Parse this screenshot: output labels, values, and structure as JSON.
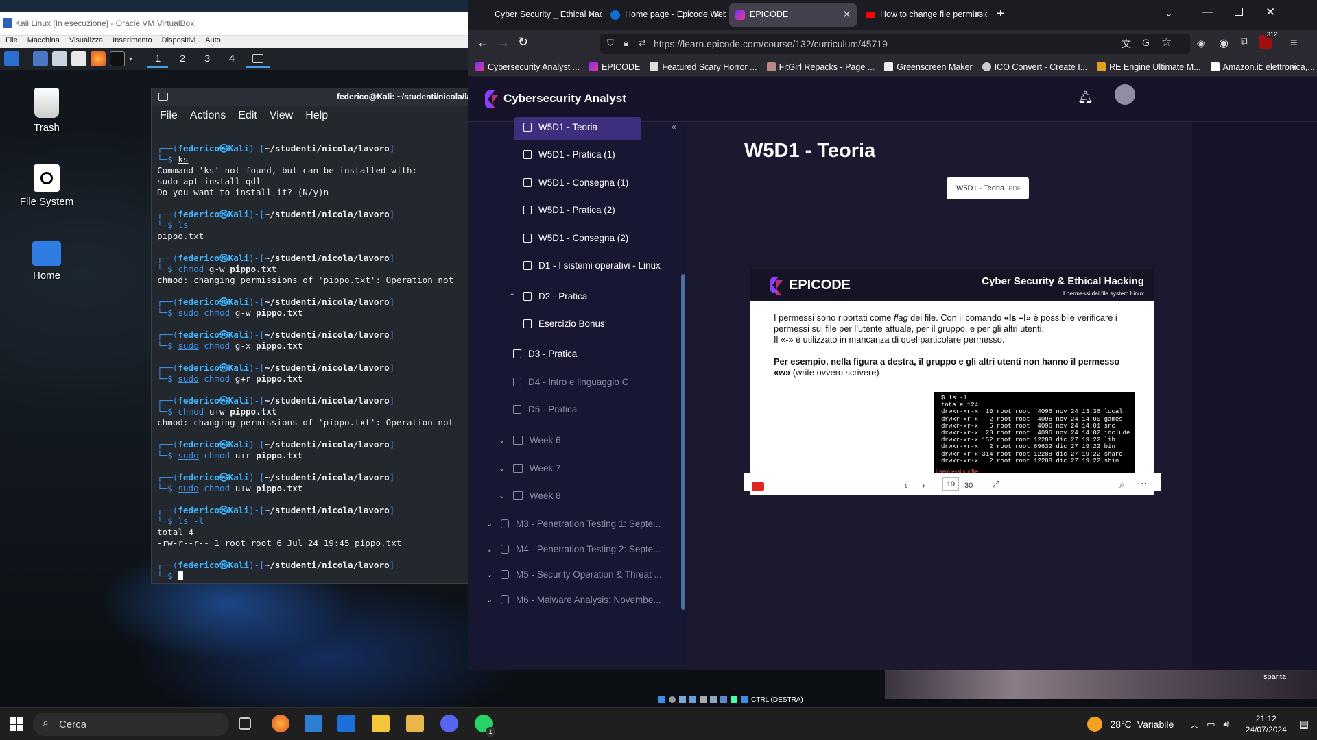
{
  "vbox": {
    "title": "Kali Linux [In esecuzione] - Oracle VM VirtualBox",
    "menu": [
      "File",
      "Macchina",
      "Visualizza",
      "Inserimento",
      "Dispositivi",
      "Auto"
    ]
  },
  "kali": {
    "workspaces": [
      "1",
      "2",
      "3",
      "4"
    ],
    "desktop_icons": [
      "Trash",
      "File System",
      "Home"
    ],
    "terminal": {
      "title": "federico@Kali: ~/studenti/nicola/lavoro",
      "menu": [
        "File",
        "Actions",
        "Edit",
        "View",
        "Help"
      ],
      "prompt_user": "federico",
      "prompt_host": "Kali",
      "prompt_path": "~/studenti/nicola/lavoro",
      "lines": {
        "c1": "ks",
        "o1a": "Command 'ks' not found, but can be installed with:",
        "o1b": "sudo apt install qdl",
        "o1c": "Do you want to install it? (N/y)n",
        "c2": "ls",
        "o2": "pippo.txt",
        "c3a": "chmod",
        "c3b": "g-w",
        "c3c": "pippo.txt",
        "o3": "chmod: changing permissions of 'pippo.txt': Operation not",
        "sudo": "sudo",
        "chmod": "chmod",
        "c4b": "g-w",
        "c5b": "g-x",
        "c6b": "g+r",
        "c7b": "u+w",
        "o7": "chmod: changing permissions of 'pippo.txt': Operation not",
        "c8b": "u+r",
        "c9b": "u+w",
        "file": "pippo.txt",
        "c10": "ls -l",
        "o10a": "total 4",
        "o10b": "-rw-r--r-- 1 root root 6 Jul 24 19:45 pippo.txt"
      }
    }
  },
  "firefox": {
    "tabs": [
      "Cyber Security _ Ethical Hacking - M",
      "Home page - Epicode WebEx E",
      "EPICODE",
      "How to change file permission"
    ],
    "url": "https://learn.epicode.com/course/132/curriculum/45719",
    "url_domain": "learn.epicode.com",
    "badge": "312",
    "bookmarks": [
      "Cybersecurity Analyst ...",
      "EPICODE",
      "Featured Scary Horror ...",
      "FitGirl Repacks - Page ...",
      "Greenscreen Maker",
      "ICO Convert - Create I...",
      "RE Engine Ultimate M...",
      "Amazon.it: elettronica,..."
    ]
  },
  "site": {
    "brand": "Cybersecurity Analyst",
    "curriculum": [
      {
        "label": "W5D1 - Teoria",
        "active": true
      },
      {
        "label": "W5D1 - Pratica (1)"
      },
      {
        "label": "W5D1 - Consegna (1)"
      },
      {
        "label": "W5D1 - Pratica (2)"
      },
      {
        "label": "W5D1 - Consegna (2)"
      },
      {
        "label": "D1 - I sistemi operativi - Linux"
      },
      {
        "label": "D2 - Pratica"
      },
      {
        "label": "Esercizio Bonus"
      },
      {
        "label": "D3 - Pratica"
      },
      {
        "label": "D4 - Intro e linguaggio C"
      },
      {
        "label": "D5 - Pratica"
      },
      {
        "label": "Week 6"
      },
      {
        "label": "Week 7"
      },
      {
        "label": "Week 8"
      },
      {
        "label": "M3 - Penetration Testing 1: Septe..."
      },
      {
        "label": "M4 - Penetration Testing 2: Septe..."
      },
      {
        "label": "M5 - Security Operation & Threat ..."
      },
      {
        "label": "M6 - Malware Analysis: Novembe..."
      }
    ],
    "lesson_title": "W5D1 - Teoria",
    "attachment": {
      "name": "W5D1 - Teoria",
      "type": "PDF"
    },
    "slide": {
      "logo": "EPICODE",
      "title": "Cyber Security & Ethical Hacking",
      "subtitle": "I permessi dei file system Linux",
      "p1a": "I permessi sono riportati come ",
      "p1b": "flag",
      "p1c": " dei file. Con il comando ",
      "p1d": "«ls –l»",
      "p1e": " è possibile verificare i permessi sui file per l’utente attuale, per il gruppo, e per gli altri utenti.",
      "p2": "Il «-» è utilizzato in mancanza di quel particolare permesso.",
      "p3a": "Per esempio, nella figura a destra, il gruppo e gli altri utenti non hanno il permesso «w»",
      "p3b": " (write ovvero scrivere)",
      "term": "$ ls -l\ntotale 124\ndrwxr-xr-x  10 root root  4096 nov 24 13:36 local\ndrwxr-xr-x   2 root root  4096 nov 24 14:00 games\ndrwxr-xr-x   5 root root  4096 nov 24 14:01 src\ndrwxr-xr-x  23 root root  4096 nov 24 14:02 include\ndrwxr-xr-x 152 root root 12288 dic 27 19:22 lib\ndrwxr-xr-x   2 root root 69632 dic 27 19:22 bin\ndrwxr-xr-x 314 root root 12288 dic 27 19:22 share\ndrwxr-xr-x   2 root root 12288 dic 27 19:22 sbin",
      "term_caption": "i permessi sui file",
      "page_no": "19"
    },
    "pdf": {
      "page": "19",
      "total": "30"
    }
  },
  "windows": {
    "search": "Cerca",
    "temp": "28°C",
    "weather": "Variabile",
    "time": "21:12",
    "date": "24/07/2024",
    "vbox_status": "CTRL (DESTRA)",
    "notif": "1",
    "corner_label": "sparita"
  },
  "colors": {
    "accent": "#3d2f7e",
    "kali_blue": "#3f8fe6",
    "ff_bg": "#1c1b22"
  }
}
